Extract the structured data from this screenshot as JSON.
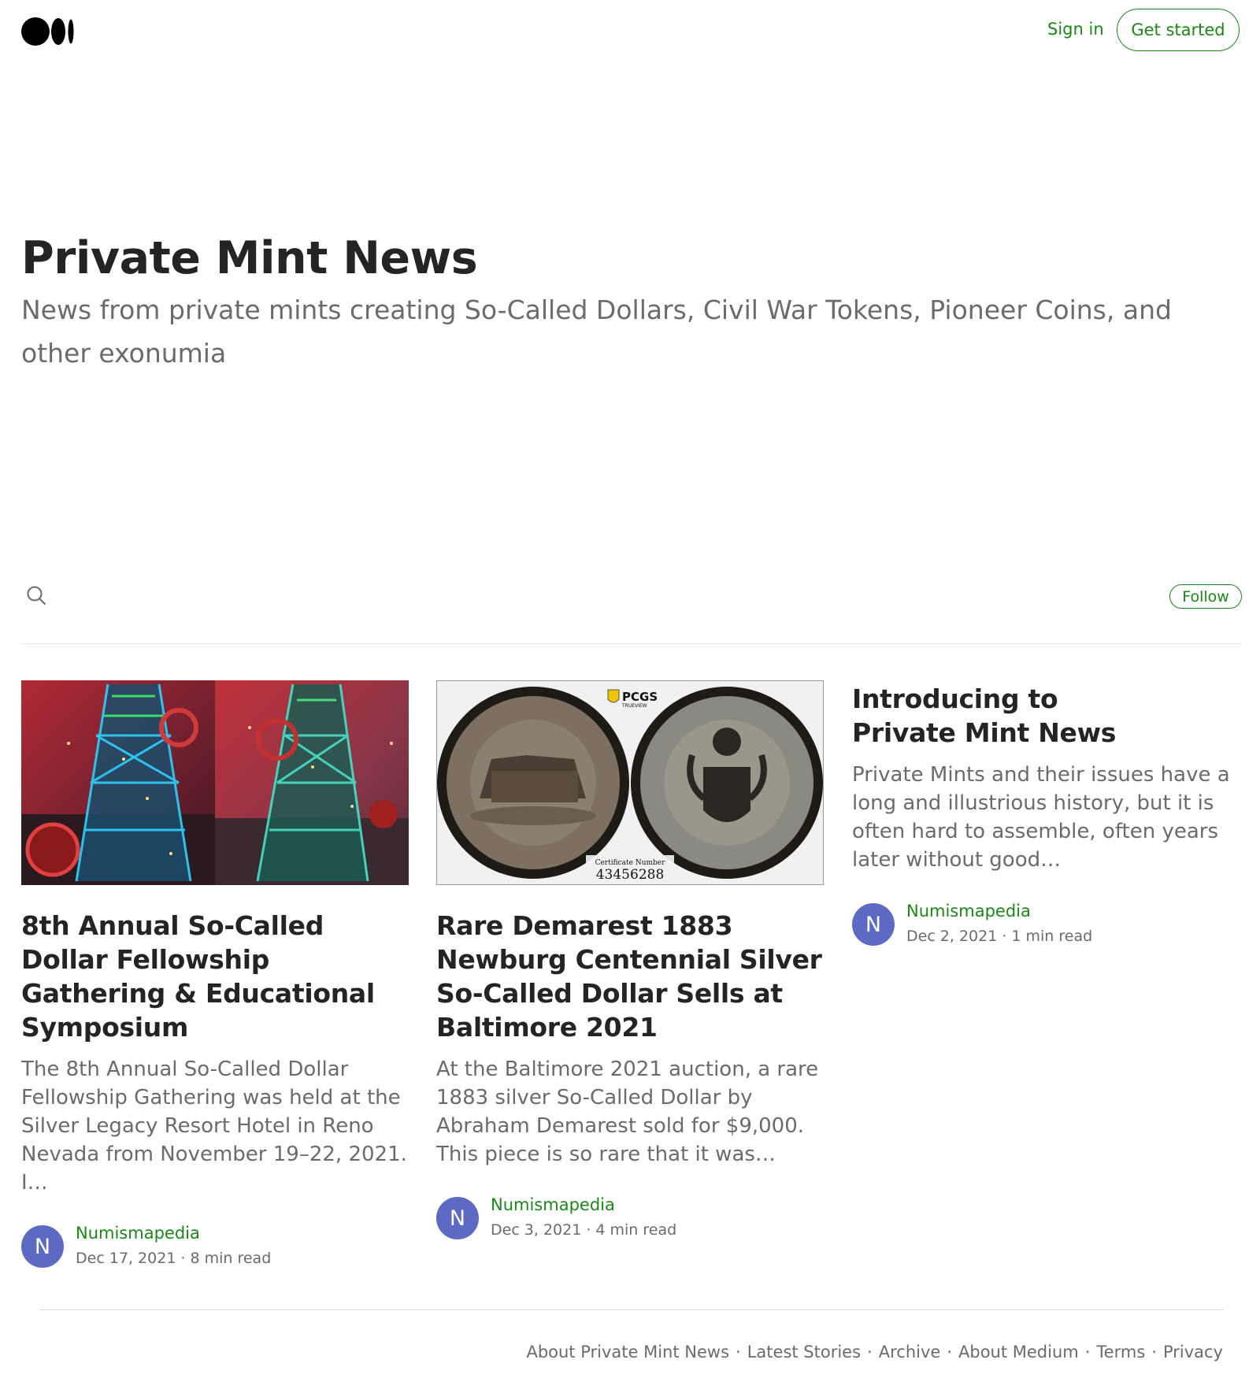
{
  "header": {
    "logo_icon": "medium-logo-icon",
    "sign_in_label": "Sign in",
    "get_started_label": "Get started"
  },
  "publication": {
    "title": "Private Mint News",
    "description": "News from private mints creating So-Called Dollars, Civil War Tokens, Pioneer Coins, and other exonumia"
  },
  "nav": {
    "search_icon": "search-icon",
    "follow_label": "Follow"
  },
  "posts": [
    {
      "title": "8th Annual So-Called Dollar Fellowship Gathering & Educational Symposium",
      "excerpt": "The 8th Annual So-Called Dollar Fellowship Gathering was held at the Silver Legacy Resort Hotel in Reno Nevada from November 19–22, 2021. I…",
      "author": "Numismapedia",
      "avatar_letter": "N",
      "date": "Dec 17, 2021",
      "read_time": "8 min read"
    },
    {
      "title": "Rare Demarest 1883 Newburg Centennial Silver So-Called Dollar Sells at Baltimore 2021",
      "excerpt": "At the Baltimore 2021 auction, a rare 1883 silver So-Called Dollar by Abraham Demarest sold for $9,000. This piece is so rare that it was…",
      "author": "Numismapedia",
      "avatar_letter": "N",
      "date": "Dec 3, 2021",
      "read_time": "4 min read",
      "image_text": {
        "badge": "PCGS",
        "badge_sub": "TRUEVIEW",
        "cert_label": "Certificate Number",
        "cert_number": "43456288"
      }
    },
    {
      "title": "Introducing to Private Mint News",
      "excerpt": "Private Mints and their issues have a long and illustrious history, but it is often hard to assemble, often years later without good…",
      "author": "Numismapedia",
      "avatar_letter": "N",
      "date": "Dec 2, 2021",
      "read_time": "1 min read"
    }
  ],
  "footer": {
    "links": [
      "About Private Mint News",
      "Latest Stories",
      "Archive",
      "About Medium",
      "Terms",
      "Privacy"
    ],
    "separator": "·"
  },
  "colors": {
    "accent": "#1a8917",
    "avatar": "#5c6ac4",
    "text": "#242424",
    "muted": "#6b6b6b"
  }
}
